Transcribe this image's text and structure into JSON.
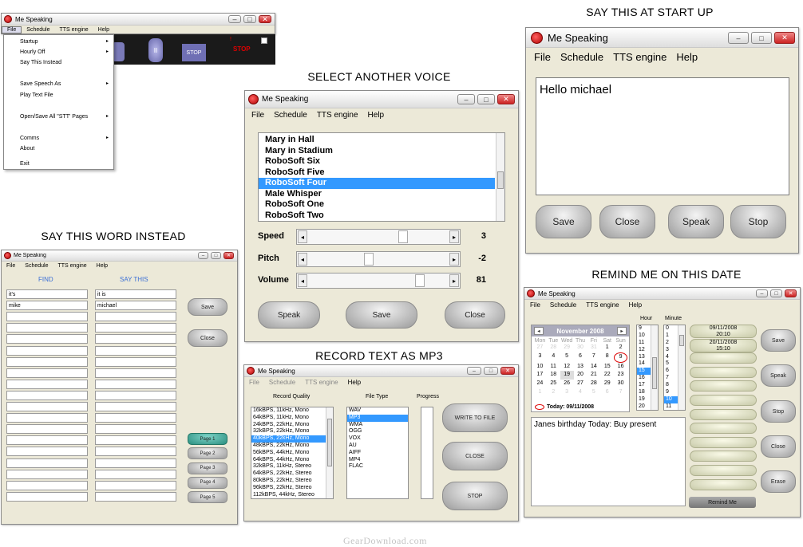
{
  "captions": {
    "startup": "SAY THIS AT START UP",
    "voice": "SELECT ANOTHER VOICE",
    "instead": "SAY THIS WORD INSTEAD",
    "remind": "REMIND ME ON THIS DATE",
    "mp3": "RECORD TEXT AS MP3"
  },
  "app_title": "Me Speaking",
  "menu": {
    "file": "File",
    "schedule": "Schedule",
    "tts": "TTS engine",
    "help": "Help"
  },
  "file_menu": {
    "items": [
      "Startup",
      "Hourly Off",
      "Say This Instead",
      "Save Speech As",
      "Play Text File",
      "Open/Save All  \"STT' Pages",
      "Comms",
      "About",
      "Exit"
    ],
    "toolbar": {
      "pause": "II",
      "stop_btn": "STOP",
      "stop_label": "STOP"
    }
  },
  "startup": {
    "text": "Hello michael",
    "buttons": {
      "save": "Save",
      "close": "Close",
      "speak": "Speak",
      "stop": "Stop"
    }
  },
  "voice": {
    "voices": [
      "Mary in Hall",
      "Mary in Stadium",
      "RoboSoft Six",
      "RoboSoft Five",
      "RoboSoft Four",
      "Male Whisper",
      "RoboSoft One",
      "RoboSoft Two"
    ],
    "selected_index": 4,
    "sliders": [
      {
        "label": "Speed",
        "value": "3",
        "level": 0.68
      },
      {
        "label": "Pitch",
        "value": "-2",
        "level": 0.42
      },
      {
        "label": "Volume",
        "value": "81",
        "level": 0.81
      }
    ],
    "buttons": {
      "speak": "Speak",
      "save": "Save",
      "close": "Close"
    }
  },
  "instead": {
    "headers": {
      "find": "FIND",
      "say": "SAY THIS"
    },
    "rows": [
      [
        "it's",
        "it is"
      ],
      [
        "mike",
        "michael"
      ]
    ],
    "buttons": {
      "save": "Save",
      "close": "Close"
    },
    "pages": [
      "Page 1",
      "Page 2",
      "Page 3",
      "Page 4",
      "Page 5"
    ]
  },
  "remind": {
    "cal_title": "November 2008",
    "weekdays": [
      "Mon",
      "Tue",
      "Wed",
      "Thu",
      "Fri",
      "Sat",
      "Sun"
    ],
    "weeks": [
      [
        "27",
        "28",
        "29",
        "30",
        "31",
        "1",
        "2"
      ],
      [
        "3",
        "4",
        "5",
        "6",
        "7",
        "8",
        "9"
      ],
      [
        "10",
        "11",
        "12",
        "13",
        "14",
        "15",
        "16"
      ],
      [
        "17",
        "18",
        "19",
        "20",
        "21",
        "22",
        "23"
      ],
      [
        "24",
        "25",
        "26",
        "27",
        "28",
        "29",
        "30"
      ],
      [
        "1",
        "2",
        "3",
        "4",
        "5",
        "6",
        "7"
      ]
    ],
    "today_label": "Today: 09/11/2008",
    "hour_label": "Hour",
    "minute_label": "Minute",
    "hours": [
      "9",
      "10",
      "11",
      "12",
      "13",
      "14",
      "15",
      "16",
      "17",
      "18",
      "19",
      "20"
    ],
    "selected_hour": "15",
    "minutes": [
      "0",
      "1",
      "2",
      "3",
      "4",
      "5",
      "6",
      "7",
      "8",
      "9",
      "10",
      "11"
    ],
    "selected_minute": "10",
    "schedule": [
      [
        "09/11/2008",
        "20:10"
      ],
      [
        "20/11/2008",
        "15:10"
      ]
    ],
    "message": "Janes birthday Today: Buy present",
    "remind_label": "Remind Me",
    "buttons": {
      "save": "Save",
      "speak": "Speak",
      "stop": "Stop",
      "close": "Close",
      "erase": "Erase"
    }
  },
  "mp3": {
    "quality_label": "Record Quality",
    "file_type_label": "File Type",
    "progress_label": "Progress",
    "progress": 0,
    "qualities": [
      "16kBPS, 11kHz, Mono",
      "64kBPS, 11kHz, Mono",
      "24kBPS, 22kHz, Mono",
      "32kBPS, 22kHz, Mono",
      "40kBPS, 22kHz, Mono",
      "48kBPS, 22kHz, Mono",
      "56kBPS, 44kHz, Mono",
      "64kBPS, 44kHz, Mono",
      "32kBPS, 11kHz, Stereo",
      "64kBPS, 22kHz, Stereo",
      "80kBPS, 22kHz, Stereo",
      "96kBPS, 22kHz, Stereo",
      "112kBPS, 44kHz, Stereo"
    ],
    "selected_quality": 4,
    "types": [
      "WAV",
      "MP3",
      "WMA",
      "OGG",
      "VOX",
      "AU",
      "AIFF",
      "MP4",
      "FLAC"
    ],
    "selected_type": 1,
    "buttons": {
      "write": "WRITE TO FILE",
      "close": "CLOSE",
      "stop": "STOP"
    }
  },
  "watermark": "GearDownload.com"
}
